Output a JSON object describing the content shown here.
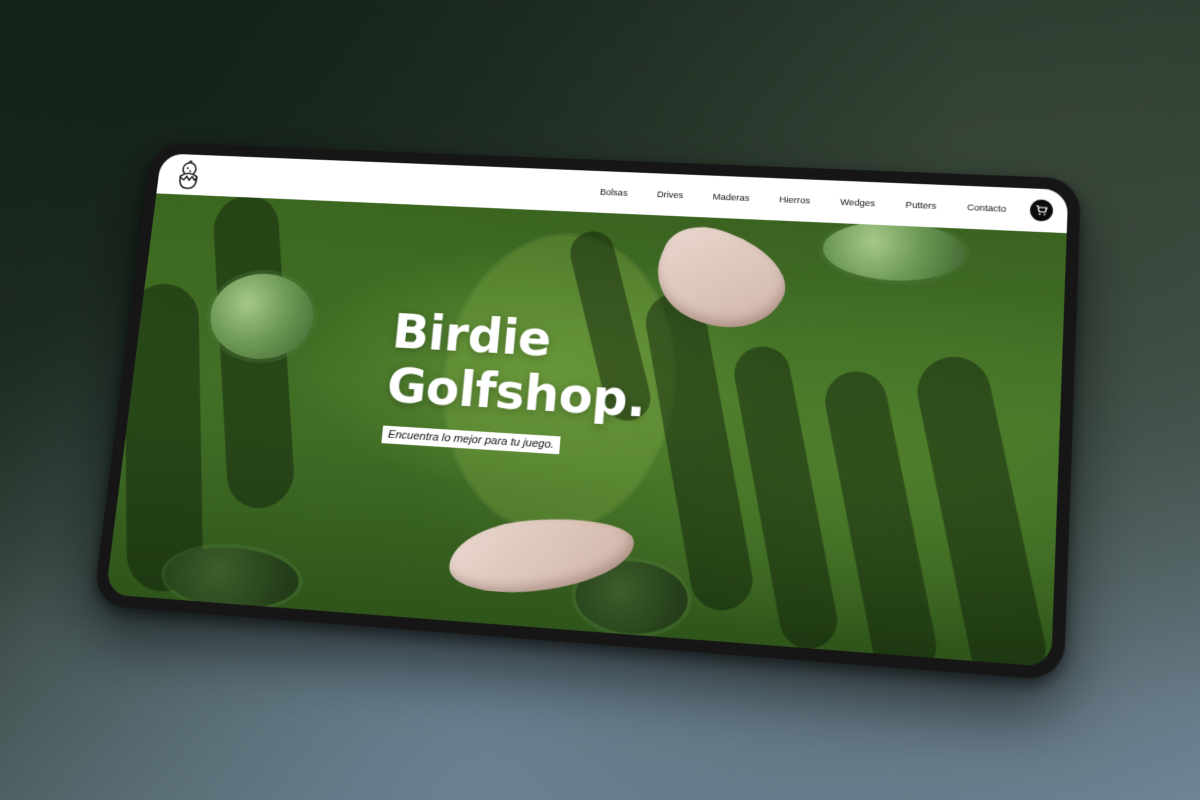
{
  "brand": {
    "logo_icon": "chick-in-egg-icon"
  },
  "nav": {
    "items": [
      {
        "label": "Bolsas"
      },
      {
        "label": "Drives"
      },
      {
        "label": "Maderas"
      },
      {
        "label": "Hierros"
      },
      {
        "label": "Wedges"
      },
      {
        "label": "Putters"
      },
      {
        "label": "Contacto"
      }
    ],
    "cart_icon": "cart-icon"
  },
  "hero": {
    "title_line1": "Birdie",
    "title_line2": "Golfshop.",
    "tagline": "Encuentra lo mejor para tu juego."
  },
  "colors": {
    "header_bg": "#ffffff",
    "text_dark": "#111111",
    "hero_text": "#ffffff",
    "grass": "#46742a",
    "bunker_sand": "#e2cbbf"
  }
}
